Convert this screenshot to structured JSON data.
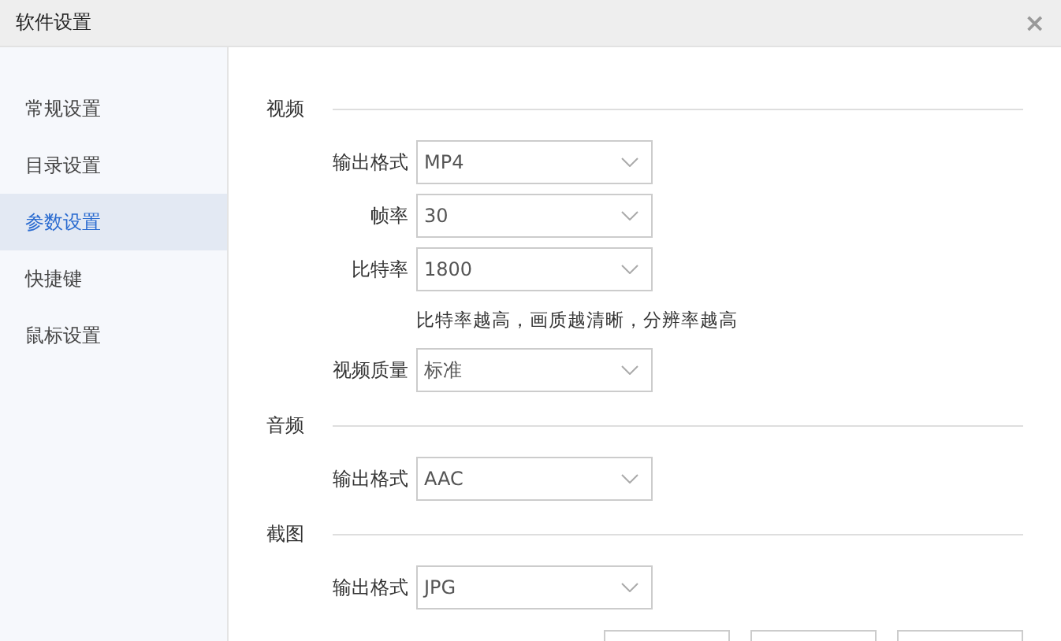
{
  "window": {
    "title": "软件设置",
    "close": "×"
  },
  "sidebar": {
    "items": [
      {
        "label": "常规设置",
        "selected": false
      },
      {
        "label": "目录设置",
        "selected": false
      },
      {
        "label": "参数设置",
        "selected": true
      },
      {
        "label": "快捷键",
        "selected": false
      },
      {
        "label": "鼠标设置",
        "selected": false
      }
    ]
  },
  "sections": [
    {
      "title": "视频",
      "fields": [
        {
          "kind": "select",
          "label": "输出格式",
          "value": "MP4"
        },
        {
          "kind": "select",
          "label": "帧率",
          "value": "30"
        },
        {
          "kind": "select",
          "label": "比特率",
          "value": "1800"
        },
        {
          "kind": "hint",
          "text": "比特率越高，画质越清晰，分辨率越高"
        },
        {
          "kind": "select",
          "label": "视频质量",
          "value": "标准"
        }
      ]
    },
    {
      "title": "音频",
      "fields": [
        {
          "kind": "select",
          "label": "输出格式",
          "value": "AAC"
        }
      ]
    },
    {
      "title": "截图",
      "fields": [
        {
          "kind": "select",
          "label": "输出格式",
          "value": "JPG"
        }
      ]
    }
  ]
}
